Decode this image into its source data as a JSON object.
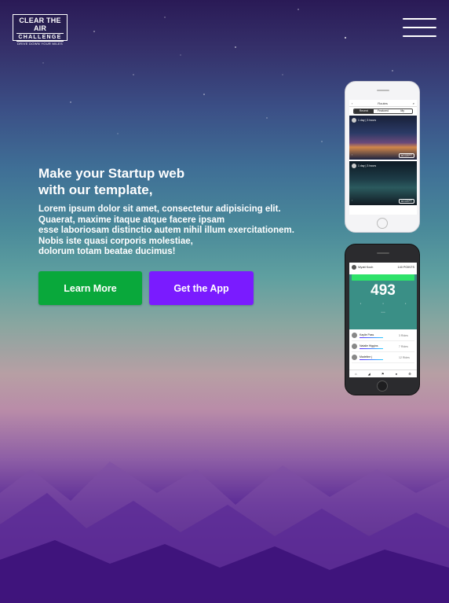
{
  "logo": {
    "line1": "CLEAR THE AIR",
    "line2": "CHALLENGE",
    "line3": "DRIVE DOWN YOUR MILES"
  },
  "menu": {
    "icon": "hamburger-menu-icon"
  },
  "hero": {
    "heading": "Make your Startup web\nwith our template,",
    "body": "Lorem ipsum dolor sit amet, consectetur adipisicing elit.\nQuaerat, maxime itaque atque facere ipsam\nesse laboriosam distinctio autem nihil illum exercitationem.\nNobis iste quasi corporis molestiae,\ndolorum totam beatae ducimus!"
  },
  "buttons": {
    "learn_more": "Learn More",
    "get_app": "Get the App"
  },
  "colors": {
    "learn_more_bg": "#09a83b",
    "get_app_bg": "#7a1bff"
  },
  "phone1": {
    "title": "Routes",
    "tabs": [
      "Recent",
      "Featured",
      "My"
    ],
    "cards": [
      {
        "meta": "1 day | 3 hours",
        "action": "ACCEPT"
      },
      {
        "meta": "1 day | 3 hours",
        "action": "ACCEPT"
      }
    ]
  },
  "phone2": {
    "user": "Wyatt Koch",
    "points": "140 POINTS",
    "value": "493",
    "rows": [
      {
        "name": "Kaylie Pass",
        "stat": "3 Rides"
      },
      {
        "name": "Natalie Higgins",
        "stat": "7 Rides"
      },
      {
        "name": "Madeline j",
        "stat": "12 Rides"
      }
    ]
  }
}
